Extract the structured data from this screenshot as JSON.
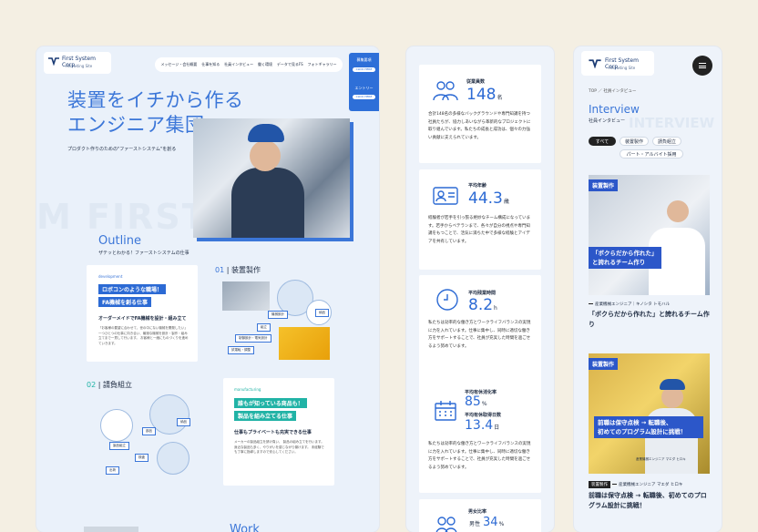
{
  "brand": {
    "name": "First System Corp.",
    "subtitle": "Recruiting Site"
  },
  "left": {
    "nav": [
      "メッセージ・会社概要",
      "仕事を知る",
      "社員インタビュー",
      "働く環境",
      "データで見るFS",
      "フォトギャラリー"
    ],
    "cta": {
      "recruit_label": "募集要項",
      "recruit_btn": "CLICK HERE",
      "entry_label": "エントリー",
      "entry_btn": "CLICK HERE"
    },
    "hero_title_1": "装置をイチから作る",
    "hero_title_2": "エンジニア集団",
    "hero_sub": "プロダクト作りのための\"ファーストシステム\"を創る",
    "bg_words": "M FIRST                        FI",
    "outline_title": "Outline",
    "outline_sub": "ザテッとわかる！ファーストシステムの仕事",
    "dev_card": {
      "tag": "development",
      "hl1": "ロボコンのような職場！",
      "hl2": "FA機械を創る仕事",
      "title": "オーダーメイドでFA機械を設計・組み立て",
      "text": "「お客様の要望に合わせて、世の中にない機械を開発したい」\n一つひとつの仕事に向き合い、最適な機械を設計・製作・組み立てまで一貫して行います。\nお客様と一緒にものづくりを進めていきます。"
    },
    "sec1": {
      "num": "01",
      "label": "装置製作"
    },
    "sec2": {
      "num": "02",
      "label": "請負組立"
    },
    "diag1": {
      "a": "機械設計",
      "b": "組立",
      "c": "納品",
      "d": "制御設計・電気設計",
      "e": "試運転・調整"
    },
    "diag2": {
      "a": "部品",
      "b": "製品組立",
      "c": "納品",
      "d": "検査",
      "e": "出荷"
    },
    "mfg_card": {
      "tag": "manufacturing",
      "hl1": "誰もが知っている商品も！",
      "hl2": "製品を組み立てる仕事",
      "title": "仕事もプライベートも充実できる仕事",
      "text": "メーカーの製品組立を請け負い、\n製品の組み立てを行います。\n身近な製品も多く、やりがいを感じながら働けます。\n未経験でも丁寧に指導しますので安心してください。"
    },
    "work_title": "Work"
  },
  "mid": {
    "stats": [
      {
        "icon": "people-icon",
        "label": "従業員数",
        "value": "148",
        "unit": "名",
        "desc": "合計148名の多様なバックグラウンドや専門知識を持つ社員たちが、協力しあいながら革新的なプロジェクトに取り組んでいます。私たちの成長と成功は、個々の力強い貢献に支えられています。"
      },
      {
        "icon": "id-card-icon",
        "label": "平均年齢",
        "value": "44.3",
        "unit": "歳",
        "desc": "経験者が若手を引っ張る絶妙なチーム構成になっています。若手からベテランまで、各々が自分の視点や専門知識をもつことで、活気に満ちた中で多様な経験とアイデアを共有しています。"
      },
      {
        "icon": "clock-icon",
        "label": "平均残業時間",
        "value": "8.2",
        "unit": "h",
        "desc": "私たちは効率的な働き方とワークライフバランスの実現に力を入れています。仕事に集中し、同時に適切な働き方をサポートすることで、社員が充実した時間を過ごせるよう努めています。"
      },
      {
        "icon": "calendar-icon",
        "label": "平均有休消化率",
        "value": "85",
        "unit": "%",
        "label2": "平均有休取得日数",
        "value2": "13.4",
        "unit2": "日",
        "desc": "私たちは効率的な働き方とワークライフバランスの実現に力を入れています。仕事に集中し、同時に適切な働き方をサポートすることで、社員が充実した時間を過ごせるよう努めています。"
      },
      {
        "icon": "gender-icon",
        "label": "男女比率",
        "value": "34",
        "unit": "%",
        "prefix": "男性"
      }
    ]
  },
  "right": {
    "breadcrumb": "TOP  ／  社員インタビュー",
    "title": "Interview",
    "subtitle": "社員インタビュー",
    "bg_word": "INTERVIEW",
    "chips": [
      "すべて",
      "装置製作",
      "請負組立",
      "パート・アルバイト採用"
    ],
    "cards": [
      {
        "tag": "装置製作",
        "caption_1": "「ボクらだから作れた」",
        "caption_2": "と誇れるチーム作り",
        "meta_dept": "産業機械エンジニア",
        "meta_name": "キノシタ トモハル",
        "title": "「ボクらだから作れた」と誇れるチーム作り"
      },
      {
        "tag": "装置製作",
        "caption_1": "前職は保守点検 → 転職後、",
        "caption_2": "初めてのプログラム設計に挑戦！",
        "meta_small": "産業機械エンジニア マエダ ヒロキ",
        "meta_badge": "装置製作",
        "meta_dept": "産業機械エンジニア",
        "meta_name": "マエダ ヒロキ",
        "title": "前職は保守点検 → 転職後、初めてのプログラム設計に挑戦！"
      }
    ]
  },
  "colors": {
    "accent": "#3b76d8",
    "teal": "#21b3a6",
    "bg": "#f4efe3"
  }
}
